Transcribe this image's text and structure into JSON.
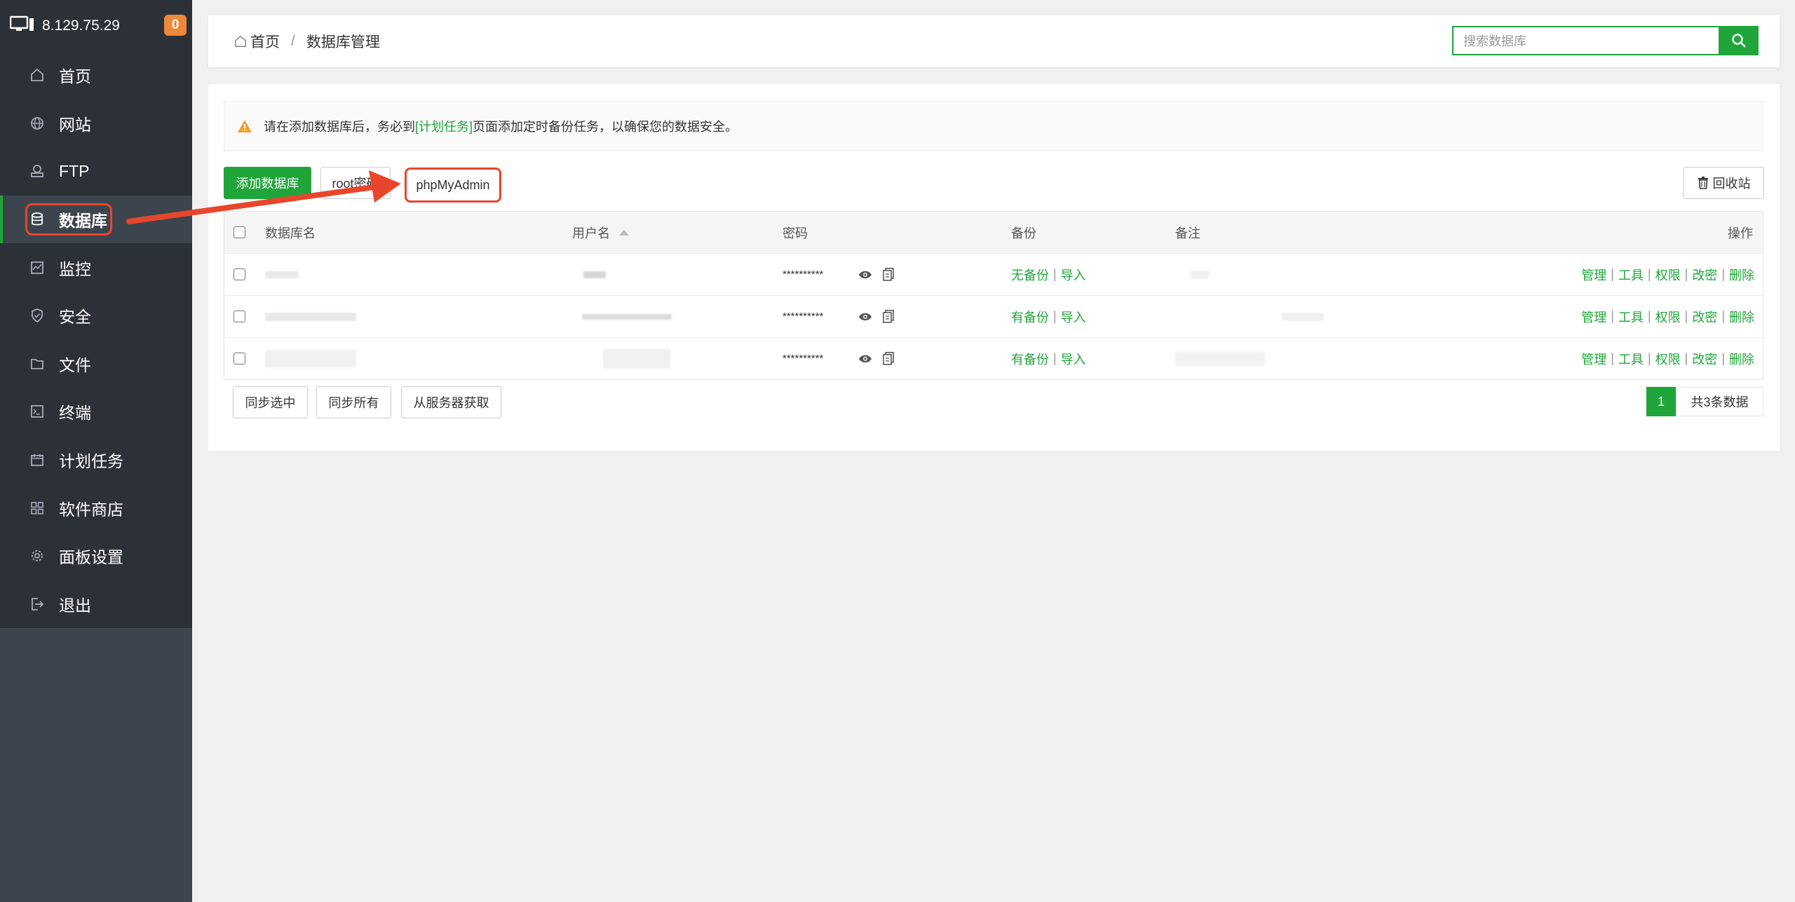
{
  "sidebar": {
    "server_ip": "8.129.75.29",
    "badge_count": "0",
    "items": [
      {
        "label": "首页",
        "icon": "home-icon"
      },
      {
        "label": "网站",
        "icon": "globe-icon"
      },
      {
        "label": "FTP",
        "icon": "ftp-icon"
      },
      {
        "label": "数据库",
        "icon": "database-icon",
        "active": true
      },
      {
        "label": "监控",
        "icon": "monitor-icon"
      },
      {
        "label": "安全",
        "icon": "shield-icon"
      },
      {
        "label": "文件",
        "icon": "folder-icon"
      },
      {
        "label": "终端",
        "icon": "terminal-icon"
      },
      {
        "label": "计划任务",
        "icon": "calendar-icon"
      },
      {
        "label": "软件商店",
        "icon": "grid-icon"
      },
      {
        "label": "面板设置",
        "icon": "gear-icon"
      },
      {
        "label": "退出",
        "icon": "logout-icon"
      }
    ]
  },
  "header": {
    "breadcrumb_home": "首页",
    "breadcrumb_sep": "/",
    "breadcrumb_current": "数据库管理",
    "search_placeholder": "搜索数据库"
  },
  "notice": {
    "prefix": "请在添加数据库后，务必到",
    "link": "[计划任务]",
    "suffix": "页面添加定时备份任务，以确保您的数据安全。"
  },
  "toolbar": {
    "add_db": "添加数据库",
    "root_password": "root密码",
    "phpmyadmin": "phpMyAdmin",
    "recycle_bin": "回收站"
  },
  "table": {
    "headers": {
      "db_name": "数据库名",
      "username": "用户名",
      "password": "密码",
      "backup": "备份",
      "note": "备注",
      "actions": "操作"
    },
    "rows": [
      {
        "password": "**********",
        "backup": "无备份",
        "import": "导入"
      },
      {
        "password": "**********",
        "backup": "有备份",
        "import": "导入"
      },
      {
        "password": "**********",
        "backup": "有备份",
        "import": "导入"
      }
    ],
    "action_labels": [
      "管理",
      "工具",
      "权限",
      "改密",
      "删除"
    ]
  },
  "footer": {
    "sync_selected": "同步选中",
    "sync_all": "同步所有",
    "fetch_from_server": "从服务器获取",
    "page": "1",
    "total": "共3条数据"
  },
  "colors": {
    "accent": "#20a53a",
    "annotation": "#e8462c",
    "sidebar_bg": "#3c444d",
    "sidebar_top": "#2c3138",
    "badge": "#f0883a"
  }
}
